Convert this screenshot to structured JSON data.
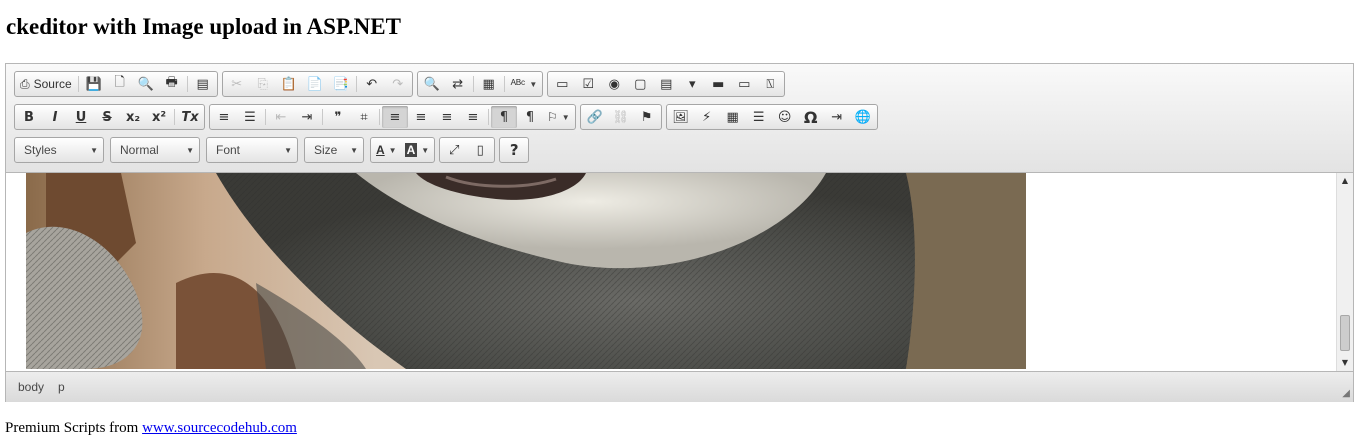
{
  "page_title": "ckeditor with Image upload in ASP.NET",
  "toolbar": {
    "source_label": "Source",
    "combos": {
      "styles": "Styles",
      "format": "Normal",
      "font": "Font",
      "size": "Size"
    },
    "glyphs": {
      "source": "⎙",
      "save": "💾",
      "new_page": "🗋",
      "preview": "🔍",
      "print": "🖶",
      "templates": "▤",
      "cut": "✂",
      "copy": "⎘",
      "paste": "📋",
      "paste_text": "📄",
      "paste_word": "📑",
      "undo": "↶",
      "redo": "↷",
      "find": "🔍",
      "replace": "⇄",
      "select_all": "▦",
      "spellcheck": "ᴬᴮᶜ",
      "form": "▭",
      "checkbox": "☑",
      "radio": "◉",
      "textfield": "▢",
      "textarea": "▤",
      "select": "▾",
      "button": "▬",
      "imagebutton": "▭",
      "hidden": "⍂",
      "bold": "B",
      "italic": "I",
      "underline": "U",
      "strike": "S",
      "subscript": "x₂",
      "superscript": "x²",
      "remove_format": "Tx",
      "numbered_list": "≡",
      "bulleted_list": "☰",
      "outdent": "⇤",
      "indent": "⇥",
      "blockquote": "❞",
      "div": "⌗",
      "align_left": "≡",
      "align_center": "≡",
      "align_right": "≡",
      "justify": "≡",
      "ltr": "¶",
      "rtl": "¶",
      "language": "⚐",
      "link": "🔗",
      "unlink": "⛓",
      "anchor": "⚑",
      "image": "🖼",
      "flash": "⚡",
      "table": "▦",
      "hr": "☰",
      "smiley": "☺",
      "special_char": "Ω",
      "page_break": "⇥",
      "iframe": "🌐",
      "text_color": "A",
      "bg_color": "A",
      "maximize": "⤢",
      "show_blocks": "▯",
      "about": "?"
    }
  },
  "elements_path": [
    "body",
    "p"
  ],
  "footer": {
    "prefix": "Premium Scripts from ",
    "link": "www.sourcecodehub.com"
  }
}
